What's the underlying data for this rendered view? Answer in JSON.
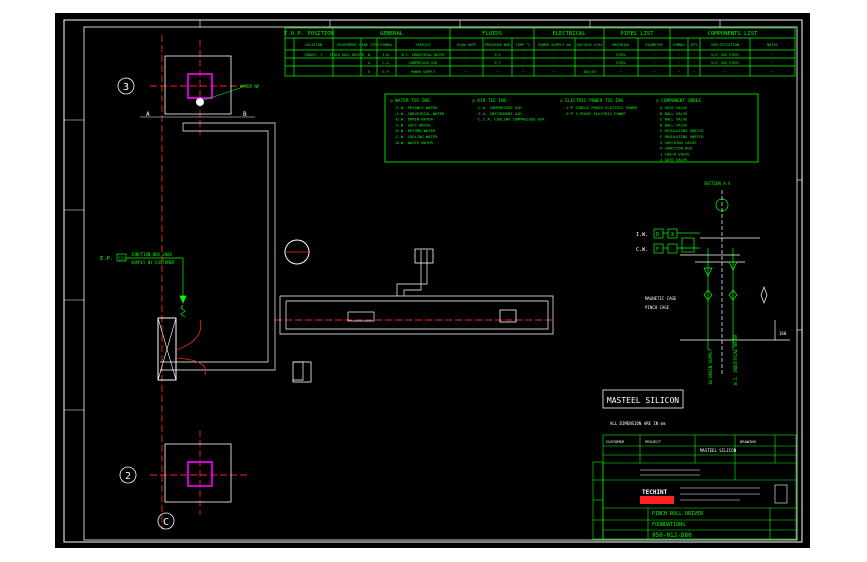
{
  "colors": {
    "background": "#000000",
    "frame": "#ffffff",
    "green": "#00ff00",
    "red": "#ff2020",
    "magenta": "#ff00ff",
    "grey": "#c8c8c8"
  },
  "grid_labels": {
    "axis3": "3",
    "axis2": "2",
    "axisC": "C",
    "dim_a": "A",
    "dim_b": "B"
  },
  "table": {
    "groups": [
      "T.O.P. POSITION",
      "GENERAL",
      "FLUIDS",
      "ELECTRICAL",
      "PIPES LIST",
      "COMPONENTS LIST"
    ],
    "headers": [
      "LOCATION",
      "EQUIPMENT",
      "LINE ITEM",
      "SYMBOL",
      "SERVICE",
      "FLOW RATE",
      "PRESSURE BAR",
      "TEMP °C",
      "POWER SUPPLY kW",
      "VOLTAGE V/Hz",
      "MATERIAL",
      "DIAMETER",
      "SYMBOL",
      "QTY",
      "SPECIFICATION",
      "NOTES"
    ],
    "rows": [
      [
        "CONVEY. C",
        "PINCH ROLL DRIVER",
        "W",
        "I.W.",
        "W.I. INDUSTRIAL WATER",
        "~",
        "3~5",
        "~",
        "~",
        "~",
        "STEEL",
        "~",
        "~",
        "~",
        "3/4\" GAS STEEL",
        "~"
      ],
      [
        "",
        "",
        "A",
        "C.A.",
        "COMPRESSED AIR",
        "~",
        "5~7",
        "~",
        "~",
        "~",
        "STEEL",
        "~",
        "~",
        "~",
        "3/4\" GAS STEEL",
        "~"
      ],
      [
        "",
        "",
        "E",
        "E.P.",
        "POWER SUPPLY",
        "~",
        "~",
        "~",
        "~",
        "380/50",
        "~",
        "~",
        "~",
        "~",
        "~",
        "~"
      ]
    ]
  },
  "legend": {
    "water_title": "WATER TIE INS",
    "water_lines": [
      "-P.W. POTABLE WATER",
      "-I.W. INDUSTRIAL WATER",
      "-D.W. DRAIN WATER",
      "-S.W. SOFT WATER",
      "-R.W. RETURN WATER",
      "-C.W. COOLING WATER",
      "-W.W. WASTE WATER"
    ],
    "air_title": "AIR TIE INS",
    "air_lines": [
      "-C.A. COMPRESSED AIR",
      "-I.A. INSTRUMENT AIR",
      "-C.C.A. COOLING COMPRESSED AIR"
    ],
    "elec_title": "ELECTRIC POWER TIE INS",
    "elec_lines": [
      "-1~P SINGLE PHASE ELECTRIC POWER",
      "-3~P 3-PHASE ELECTRIC POWER"
    ],
    "comp_title": "COMPONENT INDEX",
    "comp_lines": [
      "A GATE VALVE",
      "B BALL VALVE",
      "C BALL VALVE",
      "D BALL VALVE",
      "E REGULATING SWITCH",
      "F REGULATING SWITCH",
      "G CHECKING VALVE",
      "H JUNCTION BOX",
      "I CHECK VALVE",
      "J GATE VALVE"
    ]
  },
  "labels": {
    "water_mark": "WATER NP",
    "tag_ep": "E.P.",
    "tag_ep_box": "[3]",
    "ep_note": "JUNCTION BOX 380V",
    "ep_note2": "SUPPLY BY CUSTOMER",
    "section": "SECTION A-A",
    "iw": "I.W.",
    "cw": "C.W.",
    "magnetic_cage": "MAGNETIC CAGE",
    "pinch_cage": "PINCH CAGE",
    "tag_d": "D",
    "tag_f": "F",
    "tag_x": "X",
    "dim_h": "160",
    "vert_1": "IW DRAIN SUPPLY",
    "vert_2": "W.I. INDUSTRIAL WATER",
    "brand": "MASTEEL SILICON",
    "note_below": "ALL DIMENSION ARE IN mm"
  },
  "title_block": {
    "company": "TECHINT",
    "title1": "PINCH ROLL DRIVER",
    "title2": "FOUNDATIONS",
    "doc_no": "950-012-D80",
    "project": "MASTEEL SILICON",
    "small1": "CUSTOMER",
    "small2": "PROJECT",
    "small3": "DRAWING"
  }
}
